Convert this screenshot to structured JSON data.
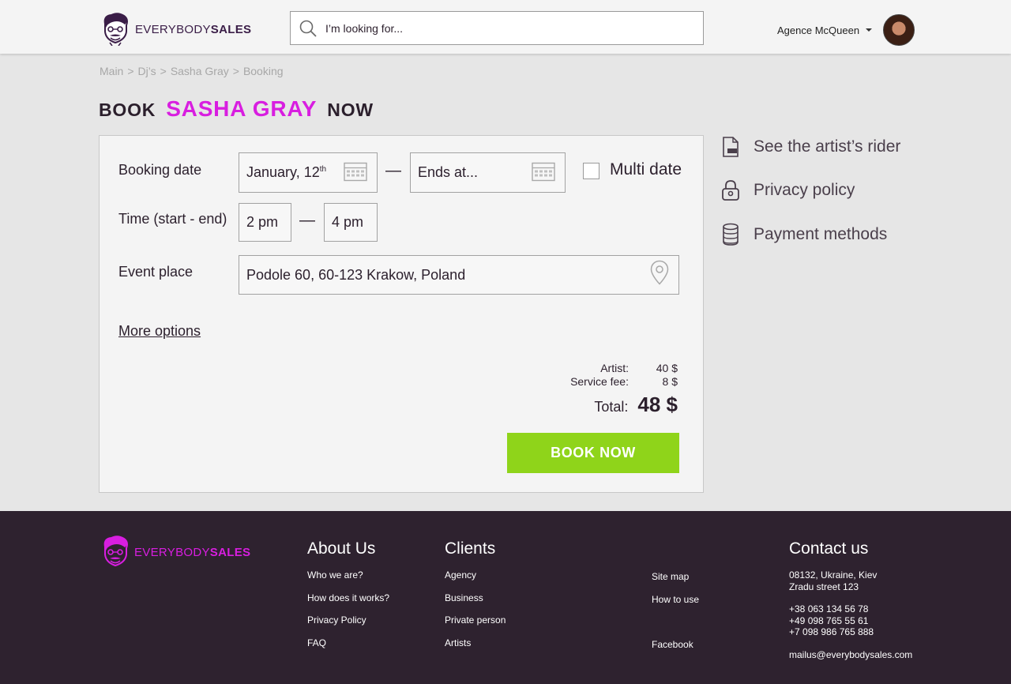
{
  "brand": {
    "logo_light": "EVERYBODY",
    "logo_bold": "SALES",
    "accent_color": "#d81ee0",
    "dark_color": "#2e222f",
    "cta_color": "#8fd41a"
  },
  "search": {
    "placeholder": "I’m looking for..."
  },
  "account": {
    "name": "Agence McQueen"
  },
  "breadcrumb": [
    "Main",
    ">",
    "Dj’s",
    ">",
    "Sasha Gray",
    ">",
    "Booking"
  ],
  "title": {
    "prefix": "BOOK",
    "artist": "SASHA GRAY",
    "suffix": "NOW"
  },
  "form": {
    "booking_date_label": "Booking date",
    "date_start": "January, 12",
    "date_start_sup": "th",
    "date_end_placeholder": "Ends at...",
    "multi_date_label": "Multi date",
    "time_label": "Time (start - end)",
    "time_start": "2 pm",
    "time_end": "4 pm",
    "event_place_label": "Event place",
    "event_place_value": "Podole 60, 60-123 Krakow, Poland",
    "dash": "—",
    "more_options": "More options"
  },
  "pricing": {
    "artist_label": "Artist:",
    "artist_value": "40 $",
    "fee_label": "Service fee:",
    "fee_value": "8 $",
    "total_label": "Total:",
    "total_value": "48 $"
  },
  "book_button": "BOOK NOW",
  "side_links": [
    {
      "label": "See the artist’s rider",
      "icon": "pdf-file-icon"
    },
    {
      "label": "Privacy policy",
      "icon": "lock-icon"
    },
    {
      "label": "Payment methods",
      "icon": "coins-icon"
    }
  ],
  "footer": {
    "about": {
      "title": "About Us",
      "links": [
        "Who we are?",
        "How does it works?",
        "Privacy Policy",
        "FAQ"
      ]
    },
    "clients": {
      "title": "Clients",
      "links": [
        "Agency",
        "Business",
        "Private person",
        "Artists"
      ]
    },
    "misc": {
      "links": [
        "Site map",
        "How to use",
        "Facebook"
      ]
    },
    "contact": {
      "title": "Contact us",
      "address_1": "08132, Ukraine, Kiev",
      "address_2": "Zradu street 123",
      "phone_1": "+38 063 134 56 78",
      "phone_2": "+49 098 765 55 61",
      "phone_3": "+7 098 986 765 888",
      "email": "mailus@everybodysales.com"
    }
  }
}
